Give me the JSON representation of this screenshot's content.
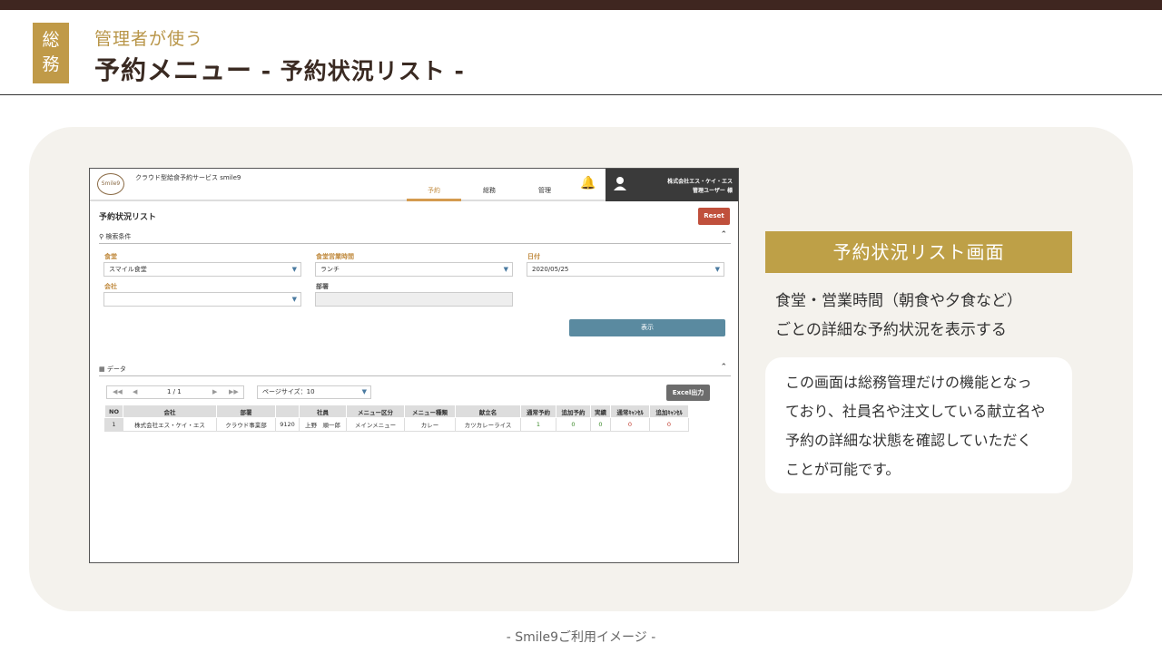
{
  "header": {
    "category_line1": "総",
    "category_line2": "務",
    "subtitle": "管理者が使う",
    "title": "予約メニュー",
    "title_suffix": " - 予約状況リスト -"
  },
  "app": {
    "logo_text": "Smile9",
    "service_name": "クラウド型給食予約サービス  smile9",
    "nav_tabs": [
      "予約",
      "総務",
      "管理"
    ],
    "active_tab": "予約",
    "user_company": "株式会社エス・ケイ・エス",
    "user_role": "管理ユーザー 様",
    "page_name": "予約状況リスト",
    "reset_label": "Reset",
    "search_section": "検索条件",
    "fields": {
      "cafeteria_label": "食堂",
      "cafeteria_value": "スマイル食堂",
      "hours_label": "食堂営業時間",
      "hours_value": "ランチ",
      "date_label": "日付",
      "date_value": "2020/05/25",
      "company_label": "会社",
      "company_value": "",
      "dept_label": "部署",
      "dept_value": ""
    },
    "show_label": "表示",
    "data_section": "データ",
    "pager_text": "1 / 1",
    "page_size": "ページサイズ：10",
    "excel_label": "Excel出力",
    "table": {
      "headers": [
        "NO",
        "会社",
        "部署",
        "",
        "社員",
        "メニュー区分",
        "メニュー種類",
        "献立名",
        "通常予約",
        "追加予約",
        "実績",
        "通常ｷｬﾝｾﾙ",
        "追加ｷｬﾝｾﾙ"
      ],
      "row": [
        "1",
        "株式会社エス・ケイ・エス",
        "クラウド事業部",
        "9120",
        "上野　順一郎",
        "メインメニュー",
        "カレー",
        "カツカレーライス",
        "1",
        "0",
        "0",
        "0",
        "0"
      ]
    }
  },
  "info": {
    "title": "予約状況リスト画面",
    "desc_line1": "食堂・営業時間（朝食や夕食など）",
    "desc_line2": "ごとの詳細な予約状況を表示する",
    "card_lines": [
      "この画面は総務管理だけの機能となっ",
      "ており、社員名や注文している献立名や",
      "予約の詳細な状態を確認していただく",
      "ことが可能です。"
    ]
  },
  "footer": "- Smile9ご利用イメージ -",
  "colors": {
    "brown": "#3f2620",
    "gold": "#bea047",
    "panel": "#f4f2ed"
  }
}
